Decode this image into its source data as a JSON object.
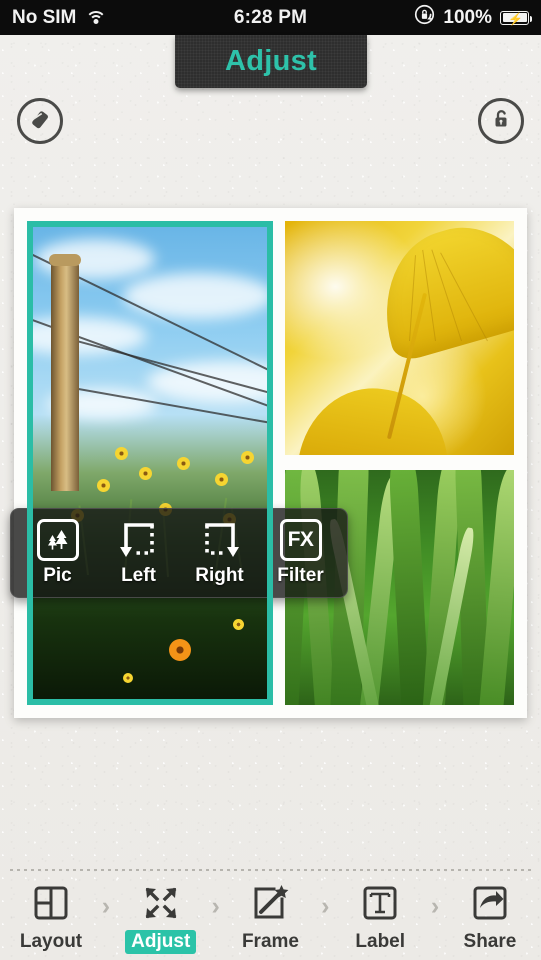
{
  "status_bar": {
    "carrier": "No SIM",
    "wifi_icon": "wifi-icon",
    "time": "6:28 PM",
    "rotation_lock_icon": "rotation-lock-icon",
    "battery_percent": "100%",
    "battery_icon": "battery-charging-icon"
  },
  "header": {
    "title": "Adjust",
    "title_color": "#2ec2aa",
    "left_button_icon": "eraser-icon",
    "right_button_icon": "unlock-icon"
  },
  "canvas": {
    "selection_color": "#2bbda6",
    "cells": [
      {
        "name": "photo-flowers-fencepost",
        "selected": true
      },
      {
        "name": "photo-ginkgo-leaf",
        "selected": false
      },
      {
        "name": "photo-green-grass",
        "selected": false
      }
    ]
  },
  "popup_menu": {
    "items": [
      {
        "label": "Pic",
        "icon": "trees-icon"
      },
      {
        "label": "Left",
        "icon": "rotate-left-icon"
      },
      {
        "label": "Right",
        "icon": "rotate-right-icon"
      },
      {
        "label": "Filter",
        "icon": "fx-icon"
      }
    ]
  },
  "bottom_nav": {
    "separator": "›",
    "active_color": "#2bc3a8",
    "items": [
      {
        "label": "Layout",
        "icon": "layout-split-icon",
        "active": false
      },
      {
        "label": "Adjust",
        "icon": "expand-arrows-icon",
        "active": true
      },
      {
        "label": "Frame",
        "icon": "magic-wand-icon",
        "active": false
      },
      {
        "label": "Label",
        "icon": "text-t-icon",
        "active": false
      },
      {
        "label": "Share",
        "icon": "share-arrow-icon",
        "active": false
      }
    ]
  }
}
